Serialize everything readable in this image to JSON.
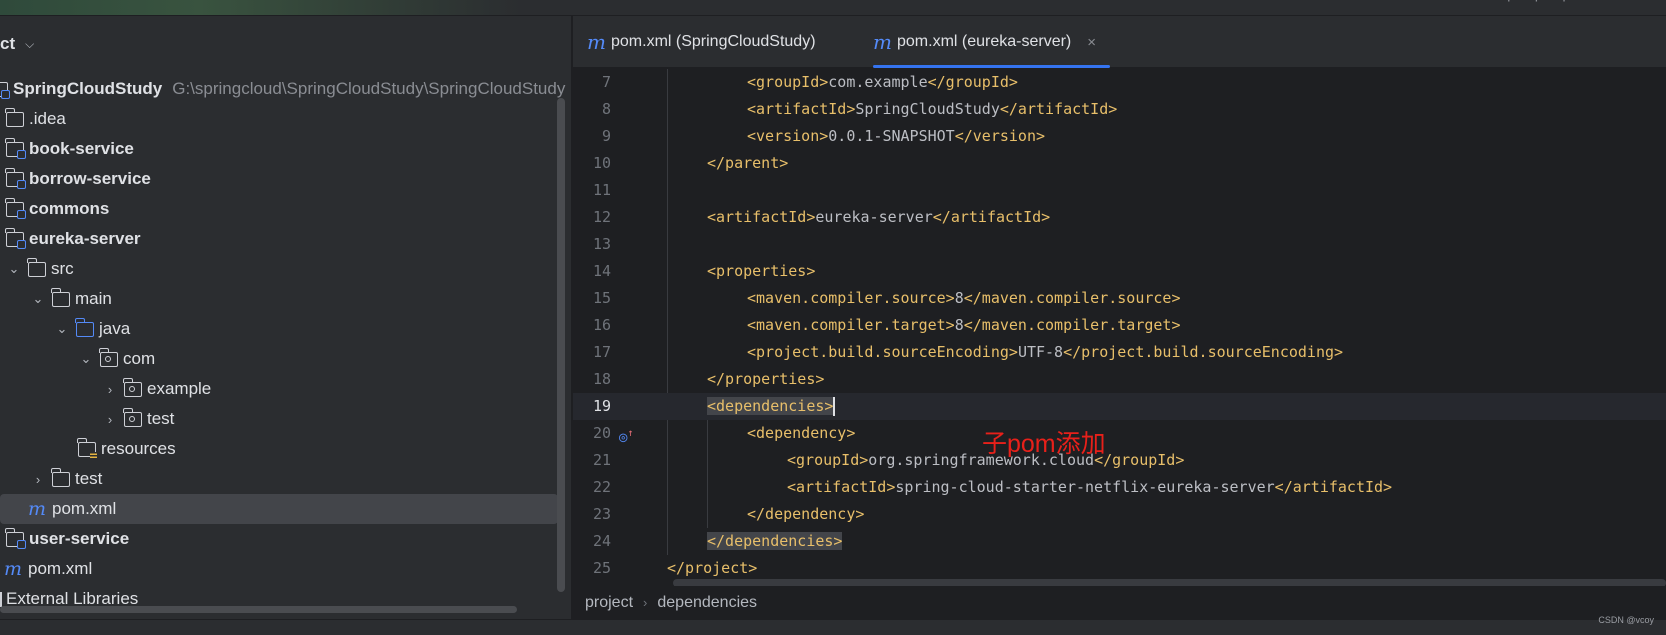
{
  "sidebar": {
    "title": "ct",
    "items": [
      {
        "label": "SpringCloudStudy",
        "path": "G:\\springcloud\\SpringCloudStudy\\SpringCloudStudy",
        "icon": "module-folder-icon",
        "bold": true
      },
      {
        "label": ".idea",
        "icon": "folder-icon"
      },
      {
        "label": "book-service",
        "icon": "module-folder-icon",
        "bold": true
      },
      {
        "label": "borrow-service",
        "icon": "module-folder-icon",
        "bold": true
      },
      {
        "label": "commons",
        "icon": "module-folder-icon",
        "bold": true
      },
      {
        "label": "eureka-server",
        "icon": "module-folder-icon",
        "bold": true
      },
      {
        "label": "src",
        "icon": "folder-icon"
      },
      {
        "label": "main",
        "icon": "folder-icon"
      },
      {
        "label": "java",
        "icon": "source-folder-icon"
      },
      {
        "label": "com",
        "icon": "package-icon"
      },
      {
        "label": "example",
        "icon": "package-icon"
      },
      {
        "label": "test",
        "icon": "package-icon"
      },
      {
        "label": "resources",
        "icon": "resources-folder-icon"
      },
      {
        "label": "test",
        "icon": "folder-icon"
      },
      {
        "label": "pom.xml",
        "icon": "maven-icon",
        "selected": true
      },
      {
        "label": "user-service",
        "icon": "module-folder-icon",
        "bold": true
      },
      {
        "label": "pom.xml",
        "icon": "maven-icon"
      },
      {
        "label": "External Libraries",
        "icon": "library-icon"
      }
    ]
  },
  "tabs": [
    {
      "label": "pom.xml (SpringCloudStudy)",
      "icon": "maven-icon"
    },
    {
      "label": "pom.xml (eureka-server)",
      "icon": "maven-icon",
      "active": true,
      "close": "×"
    }
  ],
  "editor": {
    "lines": [
      {
        "n": "7"
      },
      {
        "n": "8"
      },
      {
        "n": "9"
      },
      {
        "n": "10"
      },
      {
        "n": "11"
      },
      {
        "n": "12"
      },
      {
        "n": "13"
      },
      {
        "n": "14"
      },
      {
        "n": "15"
      },
      {
        "n": "16"
      },
      {
        "n": "17"
      },
      {
        "n": "18"
      },
      {
        "n": "19"
      },
      {
        "n": "20"
      },
      {
        "n": "21"
      },
      {
        "n": "22"
      },
      {
        "n": "23"
      },
      {
        "n": "24"
      },
      {
        "n": "25"
      }
    ],
    "code": {
      "l7_tag_open": "<groupId>",
      "l7_val": "com.example",
      "l7_tag_close": "</groupId>",
      "l8_tag_open": "<artifactId>",
      "l8_val": "SpringCloudStudy",
      "l8_tag_close": "</artifactId>",
      "l9_tag_open": "<version>",
      "l9_val": "0.0.1-SNAPSHOT",
      "l9_tag_close": "</version>",
      "l10": "</parent>",
      "l12_tag_open": "<artifactId>",
      "l12_val": "eureka-server",
      "l12_tag_close": "</artifactId>",
      "l14": "<properties>",
      "l15_tag_open": "<maven.compiler.source>",
      "l15_val": "8",
      "l15_tag_close": "</maven.compiler.source>",
      "l16_tag_open": "<maven.compiler.target>",
      "l16_val": "8",
      "l16_tag_close": "</maven.compiler.target>",
      "l17_tag_open": "<project.build.sourceEncoding>",
      "l17_val": "UTF-8",
      "l17_tag_close": "</project.build.sourceEncoding>",
      "l18": "</properties>",
      "l19": "<dependencies>",
      "l20": "<dependency>",
      "l21_tag_open": "<groupId>",
      "l21_val": "org.springframework.cloud",
      "l21_tag_close": "</groupId>",
      "l22_tag_open": "<artifactId>",
      "l22_val": "spring-cloud-starter-netflix-eureka-server",
      "l22_tag_close": "</artifactId>",
      "l23": "</dependency>",
      "l24": "</dependencies>",
      "l25": "</project>"
    },
    "annotation": "子pom添加"
  },
  "breadcrumb": {
    "items": [
      "project",
      "dependencies"
    ],
    "separator": "›"
  },
  "watermark": "CSDN @vcoy",
  "colors": {
    "tag": "#e8bf6a",
    "value": "#bcbec4",
    "accent": "#3574f0",
    "annotation": "#e8201a"
  }
}
